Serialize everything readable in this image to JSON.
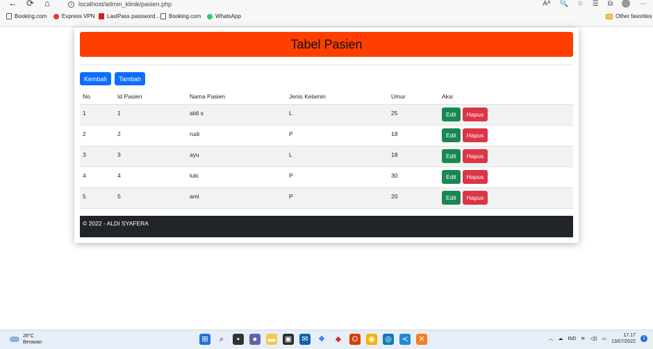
{
  "browser": {
    "url": "localhost/admin_klinik/pasien.php",
    "nav": {
      "back": "←",
      "refresh": "⟳",
      "home": "⌂"
    },
    "right_tools": [
      "Aᴬ",
      "🔍",
      "☆",
      "☰",
      "⧉",
      "···"
    ]
  },
  "bookmarks": [
    {
      "label": "Booking.com",
      "icon": "page-icon"
    },
    {
      "label": "Express VPN",
      "icon": "vpn-icon"
    },
    {
      "label": "LastPass password...",
      "icon": "lastpass-icon"
    },
    {
      "label": "Booking.com",
      "icon": "page-icon"
    },
    {
      "label": "WhatsApp",
      "icon": "whatsapp-icon"
    }
  ],
  "other_favorites": "Other favorites",
  "page": {
    "title": "Tabel Pasien",
    "buttons": {
      "back": "Kembali",
      "add": "Tambah"
    },
    "columns": [
      "No",
      "Id Pasien",
      "Nama Pasien",
      "Jenis Kelamin",
      "Umur",
      "Aksi"
    ],
    "rows": [
      {
        "no": "1",
        "id": "1",
        "nama": "aldi s",
        "jk": "L",
        "umur": "25"
      },
      {
        "no": "2",
        "id": "2",
        "nama": "rudi",
        "jk": "P",
        "umur": "18"
      },
      {
        "no": "3",
        "id": "3",
        "nama": "ayu",
        "jk": "L",
        "umur": "18"
      },
      {
        "no": "4",
        "id": "4",
        "nama": "luki",
        "jk": "P",
        "umur": "30"
      },
      {
        "no": "5",
        "id": "5",
        "nama": "ami",
        "jk": "P",
        "umur": "20"
      }
    ],
    "actions": {
      "edit": "Edit",
      "delete": "Hapus"
    },
    "footer": "© 2022 - ALDI SYAFERA"
  },
  "taskbar": {
    "weather_temp": "28°C",
    "weather_desc": "Berawan",
    "lang": "IND",
    "time": "17.17",
    "date": "13/07/2022",
    "notifications": "1"
  },
  "colors": {
    "header": "#fe3f00",
    "primary": "#0d6efd",
    "success": "#198754",
    "danger": "#dc3545",
    "footer": "#212529"
  }
}
